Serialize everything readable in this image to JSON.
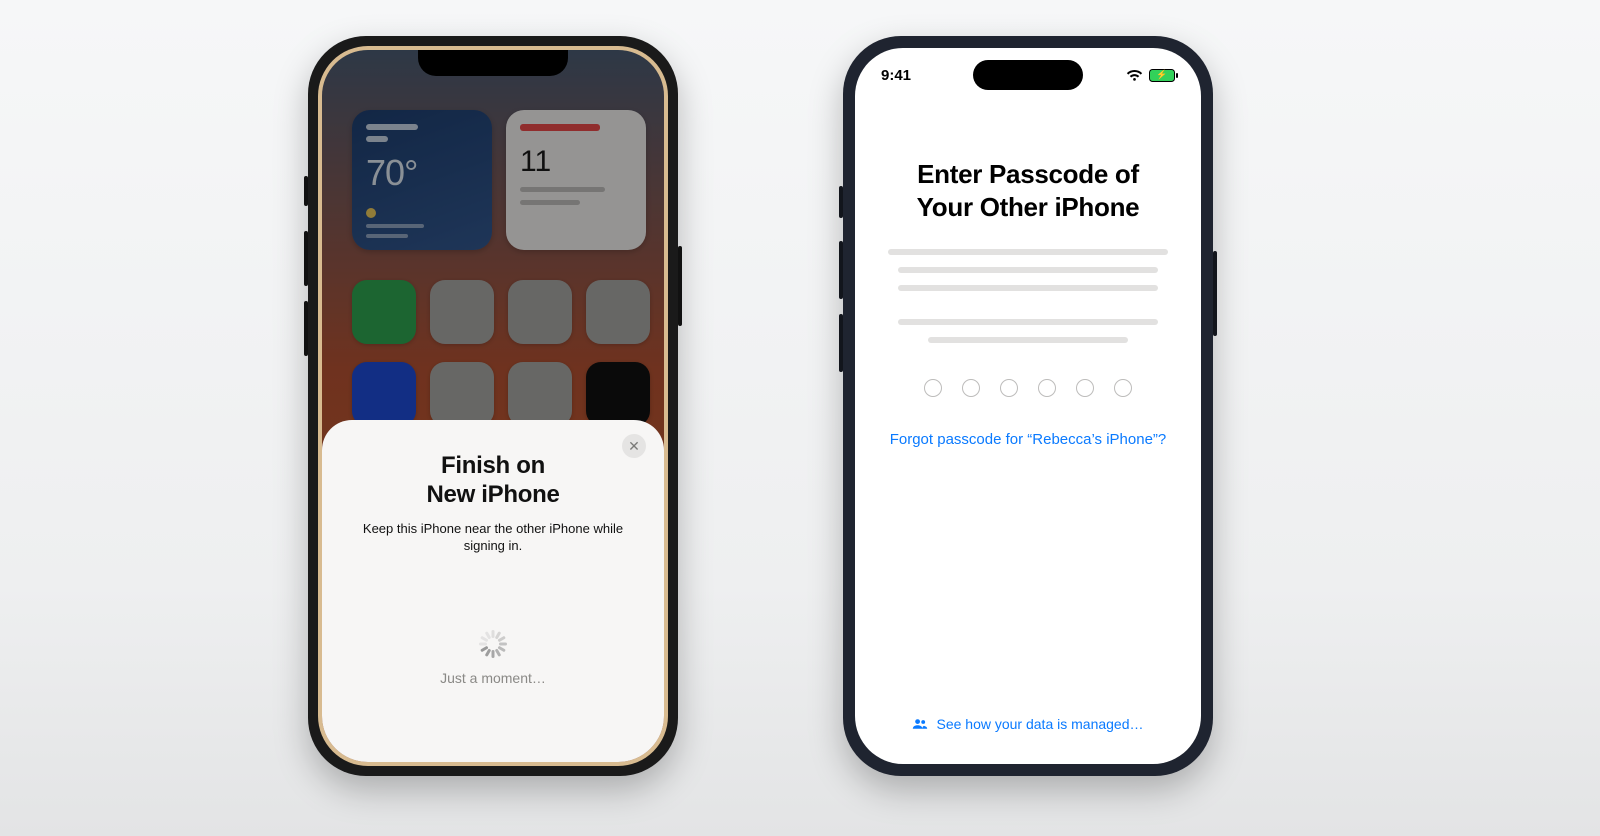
{
  "left_phone": {
    "weather_temp": "70°",
    "calendar_day": "11",
    "sheet": {
      "title_line1": "Finish on",
      "title_line2": "New iPhone",
      "subtitle": "Keep this iPhone near the other iPhone while signing in.",
      "status": "Just a moment…"
    }
  },
  "right_phone": {
    "status_time": "9:41",
    "title_line1": "Enter Passcode of",
    "title_line2": "Your Other iPhone",
    "forgot_link": "Forgot passcode for “Rebecca’s iPhone”?",
    "managed_link": "See how your data is managed…"
  }
}
